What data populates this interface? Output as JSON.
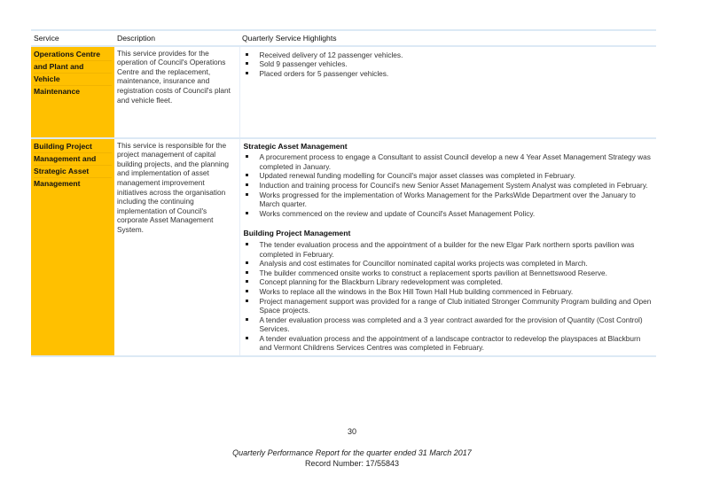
{
  "table": {
    "headers": [
      "Service",
      "Description",
      "Quarterly Service Highlights"
    ],
    "rows": [
      {
        "service_lines": [
          "Operations Centre",
          "and Plant and",
          "Vehicle",
          "Maintenance"
        ],
        "description": "This service provides for the operation of Council's Operations Centre and the replacement, maintenance, insurance and registration costs of Council's plant and vehicle fleet.",
        "sections": [
          {
            "title": "",
            "items": [
              "Received delivery of 12 passenger vehicles.",
              "Sold 9 passenger vehicles.",
              "Placed orders for 5 passenger vehicles."
            ]
          }
        ]
      },
      {
        "service_lines": [
          "Building Project",
          "Management and",
          "Strategic Asset",
          "Management"
        ],
        "description": "This service is responsible for the project management of capital building projects, and the planning and implementation of asset management improvement initiatives across the organisation including the continuing implementation of Council's corporate Asset Management System.",
        "sections": [
          {
            "title": "Strategic Asset Management",
            "items": [
              "A procurement process to engage a Consultant to assist Council develop a new 4 Year Asset Management Strategy was completed in January.",
              "Updated renewal funding modelling for Council's major asset classes was completed in February.",
              "Induction and training process for Council's new Senior Asset Management System Analyst was completed in February.",
              "Works progressed for the implementation of Works Management for the ParksWide Department over the January to March quarter.",
              "Works commenced on the review and update of Council's Asset Management Policy."
            ]
          },
          {
            "title": "Building Project Management",
            "items": [
              "The tender evaluation process and the appointment of a builder for the new Elgar Park northern sports pavilion was completed in February.",
              "Analysis and cost estimates for Councillor nominated capital works projects was completed in March.",
              "The builder commenced onsite works to construct a replacement sports pavilion at Bennettswood Reserve.",
              "Concept planning for the Blackburn Library redevelopment was completed.",
              "Works to replace all the windows in the Box Hill Town Hall Hub building commenced in February.",
              "Project management support was provided for a range of Club initiated Stronger Community Program building and Open Space projects.",
              "A tender evaluation process was completed and a 3 year contract awarded for the provision of Quantity (Cost Control) Services.",
              "A tender evaluation process and the appointment of a landscape contractor to redevelop the playspaces at Blackburn and Vermont Childrens Services Centres was completed in February."
            ]
          }
        ]
      }
    ]
  },
  "colors": {
    "service_highlight": "#ffc000",
    "table_rule": "#dce9f5"
  },
  "icons": {
    "bullet": "square-bullet-icon"
  },
  "footer": {
    "page_number": "30",
    "title": "Quarterly Performance Report for the quarter ended 31 March 2017",
    "record": "Record Number: 17/55843"
  }
}
